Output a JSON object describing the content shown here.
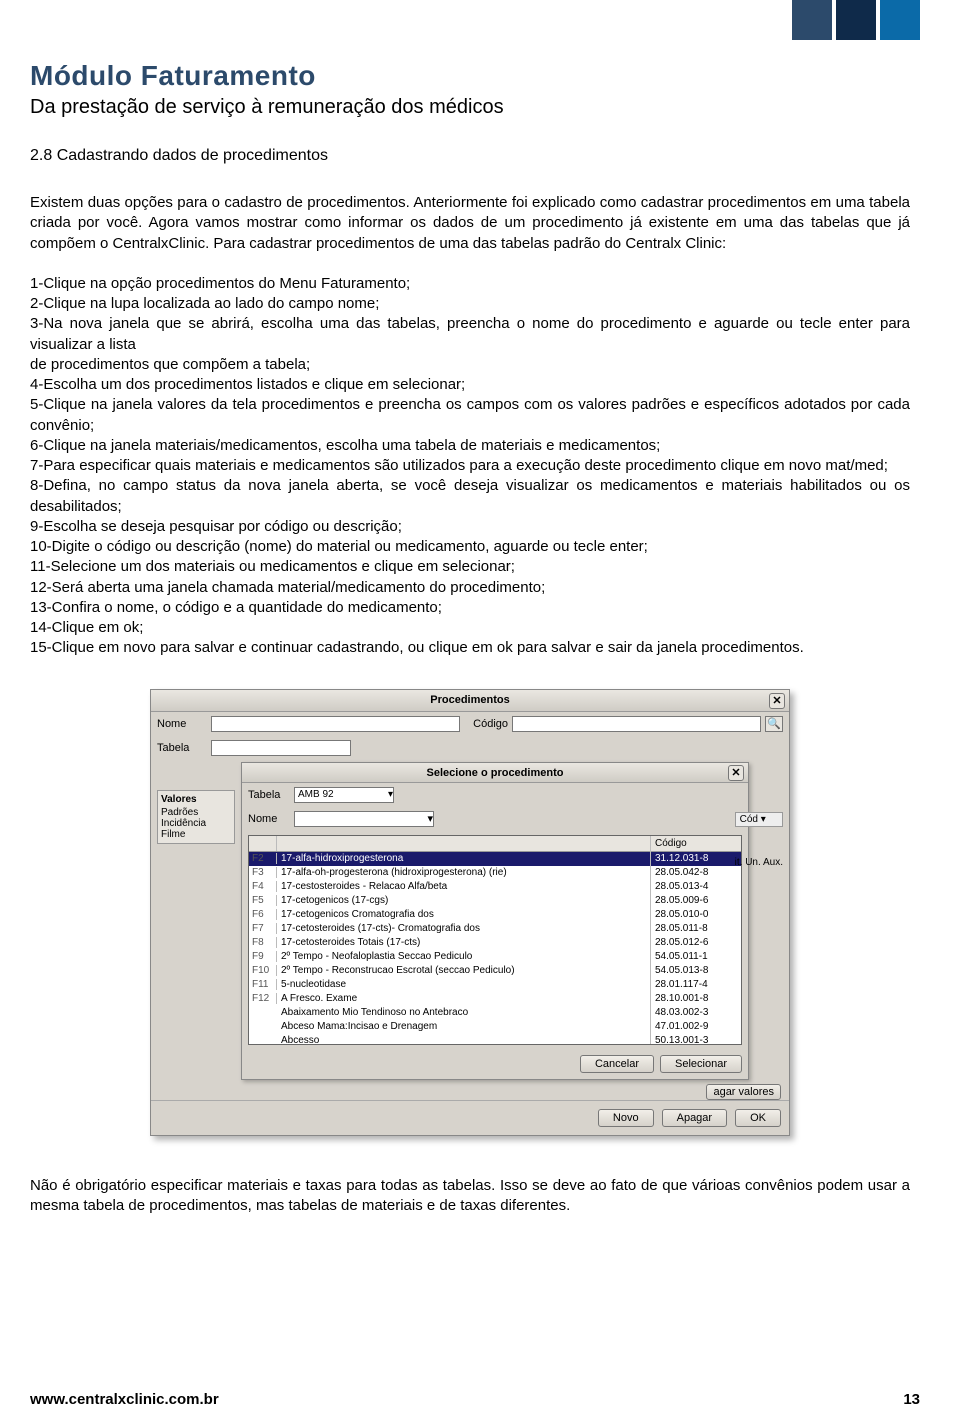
{
  "header": {
    "title": "Módulo Faturamento",
    "subtitle": "Da prestação de serviço à remuneração dos médicos",
    "section": "2.8 Cadastrando dados de procedimentos"
  },
  "intro": "Existem duas opções para o cadastro de procedimentos. Anteriormente foi explicado como cadastrar procedimentos em uma tabela criada por você. Agora vamos mostrar como informar os dados de um procedimento já existente em uma das tabelas que já compõem o CentralxClinic. Para cadastrar procedimentos de uma das tabelas padrão do Centralx Clinic:",
  "steps": [
    "1-Clique na opção procedimentos do Menu Faturamento;",
    "2-Clique na lupa localizada ao lado do campo nome;",
    "3-Na nova janela que se abrirá, escolha uma das tabelas, preencha o nome do procedimento e aguarde ou tecle enter para visualizar a lista",
    "de procedimentos que compõem a tabela;",
    "4-Escolha um dos procedimentos listados e clique em selecionar;",
    "5-Clique na janela valores da tela procedimentos e preencha os campos com os valores padrões e específicos adotados por cada convênio;",
    "6-Clique na janela materiais/medicamentos, escolha uma tabela de materiais e medicamentos;",
    "7-Para especificar quais materiais e medicamentos são utilizados para a execução deste procedimento clique em novo mat/med;",
    "8-Defina, no campo status da nova janela aberta, se você deseja visualizar os medicamentos e materiais habilitados ou os desabilitados;",
    "9-Escolha se deseja pesquisar por código ou descrição;",
    "10-Digite o código ou descrição (nome) do material ou medicamento, aguarde ou tecle enter;",
    "11-Selecione um dos materiais ou medicamentos e clique em selecionar;",
    "12-Será aberta uma janela chamada material/medicamento do procedimento;",
    "13-Confira o nome, o código e a quantidade do medicamento;",
    "14-Clique em ok;",
    "15-Clique em novo para salvar e continuar cadastrando, ou clique em ok para salvar e sair da janela procedimentos."
  ],
  "dialog": {
    "title": "Procedimentos",
    "labels": {
      "nome": "Nome",
      "codigo": "Código",
      "tabela": "Tabela"
    },
    "side": {
      "head": "Valores",
      "i1": "Padrões",
      "i2": "Incidência",
      "i3": "Filme"
    },
    "right": {
      "cod": "Cód ▾",
      "aux": "it. Un. Aux."
    },
    "inner": {
      "title": "Selecione o procedimento",
      "tabela_label": "Tabela",
      "tabela_value": "AMB 92",
      "nome_label": "Nome",
      "col_code": "Código",
      "rows": [
        {
          "fn": "F2",
          "name": "17-alfa-hidroxiprogesterona",
          "code": "31.12.031-8",
          "sel": true
        },
        {
          "fn": "F3",
          "name": "17-alfa-oh-progesterona (hidroxiprogesterona) (rie)",
          "code": "28.05.042-8"
        },
        {
          "fn": "F4",
          "name": "17-cestosteroides - Relacao Alfa/beta",
          "code": "28.05.013-4"
        },
        {
          "fn": "F5",
          "name": "17-cetogenicos (17-cgs)",
          "code": "28.05.009-6"
        },
        {
          "fn": "F6",
          "name": "17-cetogenicos Cromatografia dos",
          "code": "28.05.010-0"
        },
        {
          "fn": "F7",
          "name": "17-cetosteroides (17-cts)- Cromatografia dos",
          "code": "28.05.011-8"
        },
        {
          "fn": "F8",
          "name": "17-cetosteroides Totais (17-cts)",
          "code": "28.05.012-6"
        },
        {
          "fn": "F9",
          "name": "2º Tempo - Neofaloplastia Seccao Pediculo",
          "code": "54.05.011-1"
        },
        {
          "fn": "F10",
          "name": "2º Tempo - Reconstrucao Escrotal (seccao Pediculo)",
          "code": "54.05.013-8"
        },
        {
          "fn": "F11",
          "name": "5-nucleotidase",
          "code": "28.01.117-4"
        },
        {
          "fn": "F12",
          "name": "A Fresco. Exame",
          "code": "28.10.001-8"
        },
        {
          "fn": "",
          "name": "Abaixamento Mio Tendinoso no Antebraco",
          "code": "48.03.002-3"
        },
        {
          "fn": "",
          "name": "Abceso Mama:Incisao e Drenagem",
          "code": "47.01.002-9"
        },
        {
          "fn": "",
          "name": "Abcesso",
          "code": "50.13.001-3"
        }
      ],
      "cancel": "Cancelar",
      "select": "Selecionar"
    },
    "footer": {
      "agar": "agar valores",
      "novo": "Novo",
      "apagar": "Apagar",
      "ok": "OK"
    }
  },
  "note": "Não é obrigatório especificar materiais e taxas para todas as tabelas. Isso se deve ao fato de que várioas convênios podem usar a mesma tabela de procedimentos, mas tabelas de materiais e de taxas diferentes.",
  "footer": {
    "url": "www.centralxclinic.com.br",
    "page": "13"
  }
}
